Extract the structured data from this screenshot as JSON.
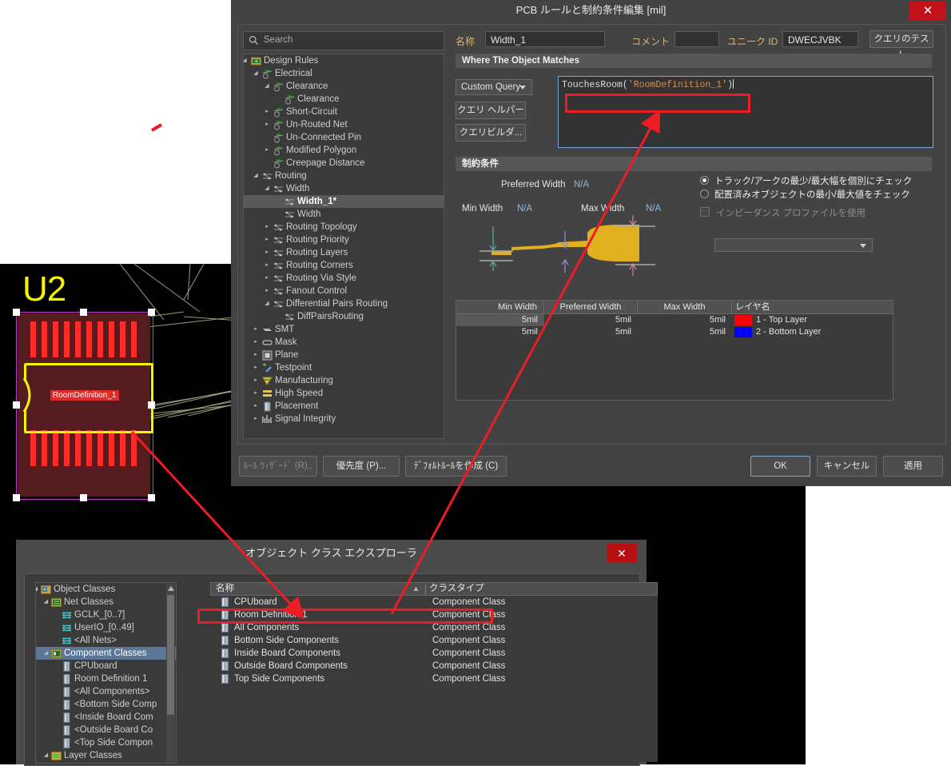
{
  "pcb": {
    "designator": "U2",
    "room_label": "RoomDefinition_1"
  },
  "rules_dialog": {
    "title": "PCB ルールと制約条件編集 [mil]",
    "close_label": "✕",
    "search": {
      "placeholder": "Search",
      "value": "",
      "icon": "search-icon"
    },
    "tree": [
      {
        "label": "Design Rules",
        "depth": 0,
        "arrow": "down",
        "icon": "design-rules-icon",
        "selected": false
      },
      {
        "label": "Electrical",
        "depth": 1,
        "arrow": "down",
        "icon": "electrical-icon",
        "selected": false
      },
      {
        "label": "Clearance",
        "depth": 2,
        "arrow": "down",
        "icon": "electrical-icon",
        "selected": false
      },
      {
        "label": "Clearance",
        "depth": 3,
        "arrow": "none",
        "icon": "electrical-icon",
        "selected": false
      },
      {
        "label": "Short-Circuit",
        "depth": 2,
        "arrow": "right",
        "icon": "electrical-icon",
        "selected": false
      },
      {
        "label": "Un-Routed Net",
        "depth": 2,
        "arrow": "right",
        "icon": "electrical-icon",
        "selected": false
      },
      {
        "label": "Un-Connected Pin",
        "depth": 2,
        "arrow": "none",
        "icon": "electrical-icon",
        "selected": false
      },
      {
        "label": "Modified Polygon",
        "depth": 2,
        "arrow": "right",
        "icon": "electrical-icon",
        "selected": false
      },
      {
        "label": "Creepage Distance",
        "depth": 2,
        "arrow": "none",
        "icon": "electrical-icon",
        "selected": false
      },
      {
        "label": "Routing",
        "depth": 1,
        "arrow": "down",
        "icon": "routing-icon",
        "selected": false
      },
      {
        "label": "Width",
        "depth": 2,
        "arrow": "down",
        "icon": "routing-icon",
        "selected": false
      },
      {
        "label": "Width_1*",
        "depth": 3,
        "arrow": "none",
        "icon": "routing-icon",
        "selected": true
      },
      {
        "label": "Width",
        "depth": 3,
        "arrow": "none",
        "icon": "routing-icon",
        "selected": false
      },
      {
        "label": "Routing Topology",
        "depth": 2,
        "arrow": "right",
        "icon": "routing-icon",
        "selected": false
      },
      {
        "label": "Routing Priority",
        "depth": 2,
        "arrow": "right",
        "icon": "routing-icon",
        "selected": false
      },
      {
        "label": "Routing Layers",
        "depth": 2,
        "arrow": "right",
        "icon": "routing-icon",
        "selected": false
      },
      {
        "label": "Routing Corners",
        "depth": 2,
        "arrow": "right",
        "icon": "routing-icon",
        "selected": false
      },
      {
        "label": "Routing Via Style",
        "depth": 2,
        "arrow": "right",
        "icon": "routing-icon",
        "selected": false
      },
      {
        "label": "Fanout Control",
        "depth": 2,
        "arrow": "right",
        "icon": "routing-icon",
        "selected": false
      },
      {
        "label": "Differential Pairs Routing",
        "depth": 2,
        "arrow": "down",
        "icon": "routing-icon",
        "selected": false
      },
      {
        "label": "DiffPairsRouting",
        "depth": 3,
        "arrow": "none",
        "icon": "routing-icon",
        "selected": false
      },
      {
        "label": "SMT",
        "depth": 1,
        "arrow": "right",
        "icon": "smt-icon",
        "selected": false
      },
      {
        "label": "Mask",
        "depth": 1,
        "arrow": "right",
        "icon": "mask-icon",
        "selected": false
      },
      {
        "label": "Plane",
        "depth": 1,
        "arrow": "right",
        "icon": "plane-icon",
        "selected": false
      },
      {
        "label": "Testpoint",
        "depth": 1,
        "arrow": "right",
        "icon": "testpoint-icon",
        "selected": false
      },
      {
        "label": "Manufacturing",
        "depth": 1,
        "arrow": "right",
        "icon": "manufacturing-icon",
        "selected": false
      },
      {
        "label": "High Speed",
        "depth": 1,
        "arrow": "right",
        "icon": "highspeed-icon",
        "selected": false
      },
      {
        "label": "Placement",
        "depth": 1,
        "arrow": "right",
        "icon": "placement-icon",
        "selected": false
      },
      {
        "label": "Signal Integrity",
        "depth": 1,
        "arrow": "right",
        "icon": "signalintegrity-icon",
        "selected": false
      }
    ],
    "fields": {
      "name_label": "名称",
      "name_value": "Width_1",
      "comment_label": "コメント",
      "comment_value": "",
      "unique_id_label": "ユニーク ID",
      "unique_id_value": "DWECJVBK",
      "test_query_button": "クエリのテスト"
    },
    "where_section": {
      "header": "Where The Object Matches",
      "scope_select": "Custom Query",
      "query_helper_button": "クエリ ヘルパー ...",
      "query_builder_button": "クエリビルダ...",
      "query_prefix": "TouchesRoom(",
      "query_string": "'RoomDefinition_1'",
      "query_suffix": ")"
    },
    "constraints_section": {
      "header": "制約条件",
      "preferred_width_label": "Preferred Width",
      "preferred_width_value": "N/A",
      "min_width_label": "Min Width",
      "min_width_value": "N/A",
      "max_width_label": "Max Width",
      "max_width_value": "N/A",
      "radio_track_arc": "トラック/アークの最少/最大幅を個別にチェック",
      "radio_placed_objects": "配置済みオブジェクトの最小/最大値をチェック",
      "radio_selected_index": 0,
      "impedance_checkbox_label": "インピーダンス プロファイルを使用",
      "impedance_checked": false,
      "impedance_profile_value": ""
    },
    "width_table": {
      "columns": [
        "Min Width",
        "Preferred Width",
        "Max Width",
        "レイヤ名"
      ],
      "rows": [
        {
          "min": "5mil",
          "pref": "5mil",
          "max": "5mil",
          "layer": "1 - Top Layer",
          "color": "#ff0000",
          "selected": true
        },
        {
          "min": "5mil",
          "pref": "5mil",
          "max": "5mil",
          "layer": "2 - Bottom Layer",
          "color": "#0000ff",
          "selected": false
        }
      ]
    },
    "footer": {
      "rule_wizard": "ﾙｰﾙ ｳｨｻﾞｰﾄﾞ (R)..",
      "priority": "優先度 (P)...",
      "create_default": "ﾃﾞﾌｫﾙﾄﾙｰﾙを作成 (C)",
      "ok": "OK",
      "cancel": "キャンセル",
      "apply": "適用"
    }
  },
  "object_class_explorer": {
    "title": "オブジェクト クラス エクスプローラ",
    "close_label": "✕",
    "tree": [
      {
        "label": "Object Classes",
        "depth": 0,
        "arrow": "down",
        "icon": "object-classes-icon",
        "selected": false
      },
      {
        "label": "Net Classes",
        "depth": 1,
        "arrow": "down",
        "icon": "net-classes-icon",
        "selected": false
      },
      {
        "label": "GCLK_[0..7]",
        "depth": 2,
        "arrow": "none",
        "icon": "net-class-icon",
        "selected": false
      },
      {
        "label": "UserIO_[0..49]",
        "depth": 2,
        "arrow": "none",
        "icon": "net-class-icon",
        "selected": false
      },
      {
        "label": "<All Nets>",
        "depth": 2,
        "arrow": "none",
        "icon": "net-class-icon",
        "selected": false
      },
      {
        "label": "Component Classes",
        "depth": 1,
        "arrow": "down",
        "icon": "component-classes-icon",
        "selected": true
      },
      {
        "label": "CPUboard",
        "depth": 2,
        "arrow": "none",
        "icon": "component-class-icon",
        "selected": false
      },
      {
        "label": "Room Definition 1",
        "depth": 2,
        "arrow": "none",
        "icon": "component-class-icon",
        "selected": false
      },
      {
        "label": "<All Components>",
        "depth": 2,
        "arrow": "none",
        "icon": "component-class-icon",
        "selected": false
      },
      {
        "label": "<Bottom Side Comp",
        "depth": 2,
        "arrow": "none",
        "icon": "component-class-icon",
        "selected": false
      },
      {
        "label": "<Inside Board Com",
        "depth": 2,
        "arrow": "none",
        "icon": "component-class-icon",
        "selected": false
      },
      {
        "label": "<Outside Board Co",
        "depth": 2,
        "arrow": "none",
        "icon": "component-class-icon",
        "selected": false
      },
      {
        "label": "<Top Side Compon",
        "depth": 2,
        "arrow": "none",
        "icon": "component-class-icon",
        "selected": false
      },
      {
        "label": "Layer Classes",
        "depth": 1,
        "arrow": "down",
        "icon": "layer-classes-icon",
        "selected": false
      }
    ],
    "list_columns": {
      "name": "名称",
      "type": "クラスタイプ",
      "sort_indicator": "▲"
    },
    "list_rows": [
      {
        "name": "CPUboard",
        "type": "Component Class",
        "highlighted": false
      },
      {
        "name": "Room Definition 1",
        "type": "Component Class",
        "highlighted": true
      },
      {
        "name": "All Components",
        "type": "Component Class",
        "highlighted": false
      },
      {
        "name": "Bottom Side Components",
        "type": "Component Class",
        "highlighted": false
      },
      {
        "name": "Inside Board Components",
        "type": "Component Class",
        "highlighted": false
      },
      {
        "name": "Outside Board Components",
        "type": "Component Class",
        "highlighted": false
      },
      {
        "name": "Top Side Components",
        "type": "Component Class",
        "highlighted": false
      }
    ]
  },
  "annotation": {
    "color": "#ee1c25"
  }
}
